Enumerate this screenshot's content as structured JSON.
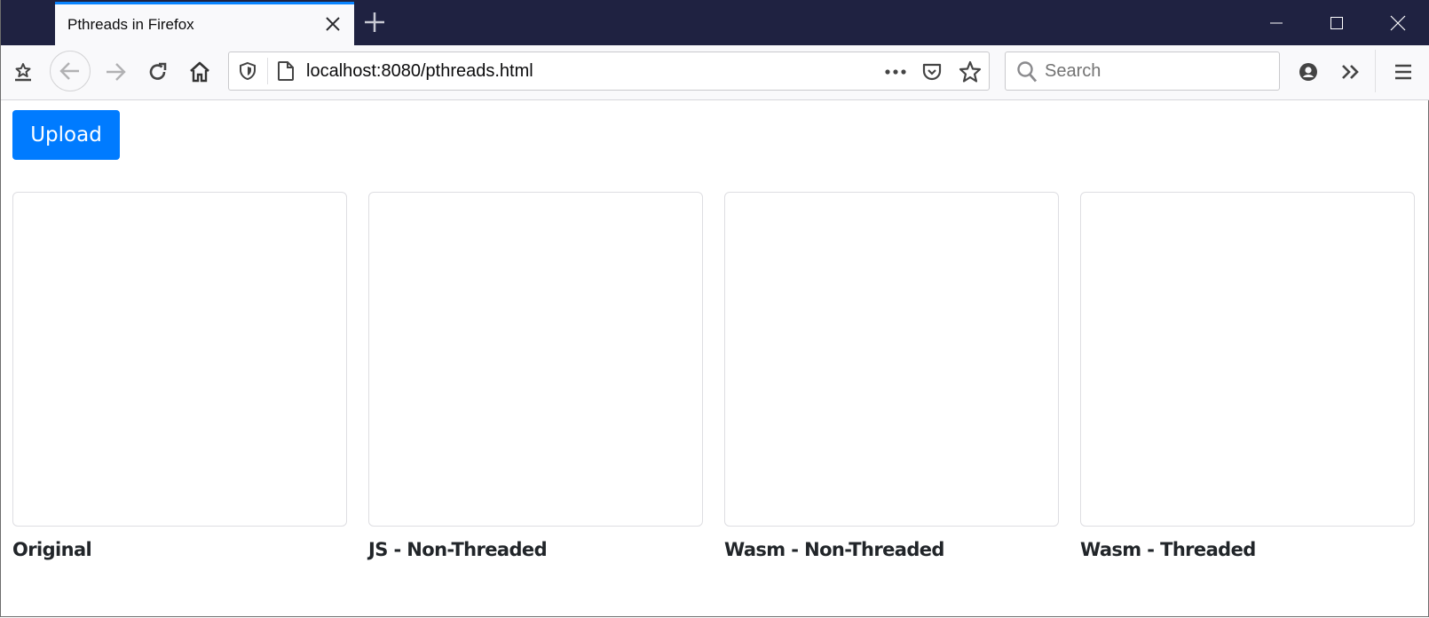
{
  "browser": {
    "tab": {
      "title": "Pthreads in Firefox"
    },
    "address_bar": {
      "url": "localhost:8080/pthreads.html"
    },
    "search_bar": {
      "placeholder": "Search"
    },
    "accent_color": "#0a84ff",
    "titlebar_color": "#1f2241"
  },
  "page": {
    "upload_button": {
      "label": "Upload",
      "color": "#007bff"
    },
    "panels": [
      {
        "label": "Original"
      },
      {
        "label": "JS - Non-Threaded"
      },
      {
        "label": "Wasm - Non-Threaded"
      },
      {
        "label": "Wasm - Threaded"
      }
    ]
  }
}
